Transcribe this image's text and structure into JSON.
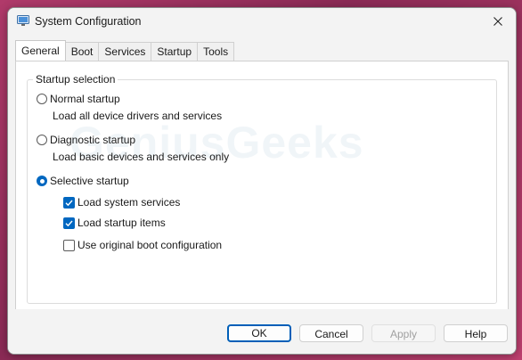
{
  "window": {
    "title": "System Configuration",
    "watermark": "GeniusGeeks"
  },
  "tabs": [
    {
      "label": "General",
      "active": true
    },
    {
      "label": "Boot",
      "active": false
    },
    {
      "label": "Services",
      "active": false
    },
    {
      "label": "Startup",
      "active": false
    },
    {
      "label": "Tools",
      "active": false
    }
  ],
  "startup": {
    "group_title": "Startup selection",
    "normal": {
      "label": "Normal startup",
      "desc": "Load all device drivers and services",
      "selected": false
    },
    "diagnostic": {
      "label": "Diagnostic startup",
      "desc": "Load basic devices and services only",
      "selected": false
    },
    "selective": {
      "label": "Selective startup",
      "selected": true
    },
    "options": [
      {
        "label": "Load system services",
        "checked": true
      },
      {
        "label": "Load startup items",
        "checked": true
      },
      {
        "label": "Use original boot configuration",
        "checked": false
      }
    ]
  },
  "buttons": {
    "ok": "OK",
    "cancel": "Cancel",
    "apply": "Apply",
    "help": "Help"
  },
  "colors": {
    "accent": "#0067c0",
    "desktop": "#9a3060"
  }
}
